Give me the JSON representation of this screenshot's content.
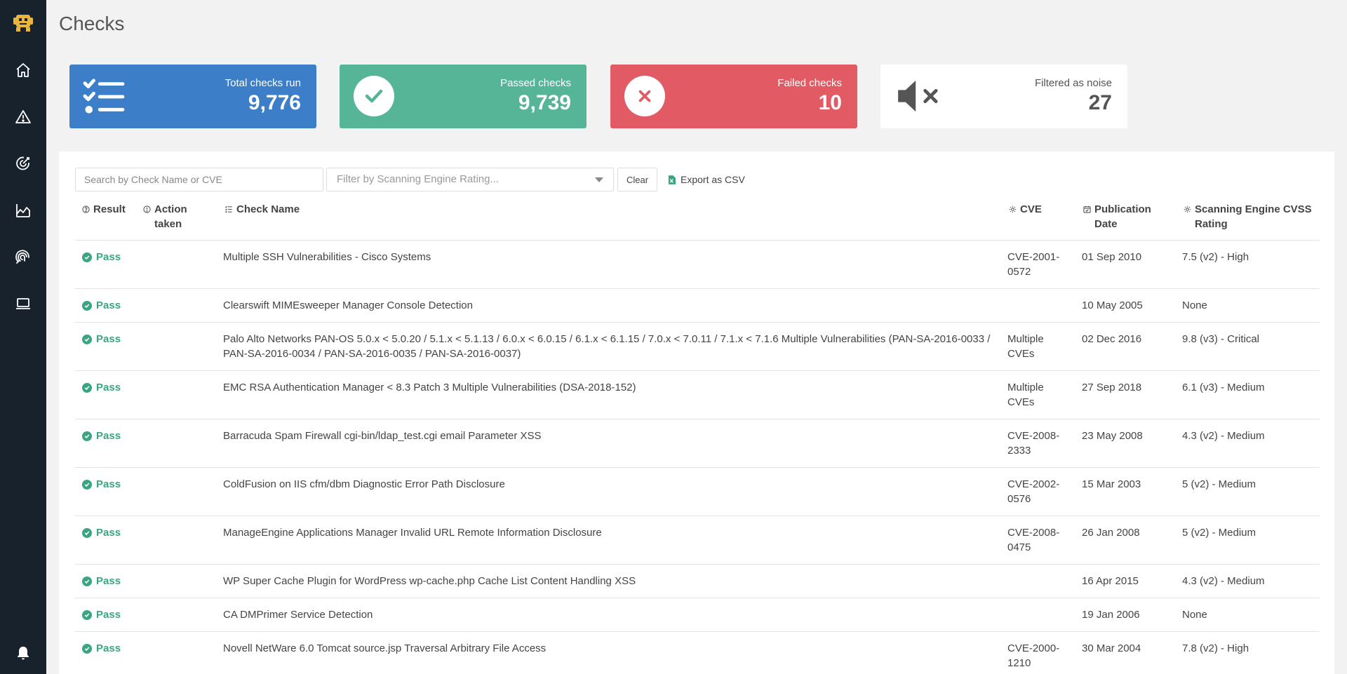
{
  "page": {
    "title": "Checks"
  },
  "colors": {
    "sidebar": "#17222c",
    "blue": "#3d7ec8",
    "green": "#56b497",
    "red": "#e25a63",
    "pass": "#3aa57f"
  },
  "sidebar": {
    "items": [
      {
        "icon": "home-icon"
      },
      {
        "icon": "warning-icon"
      },
      {
        "icon": "target-icon"
      },
      {
        "icon": "chart-icon"
      },
      {
        "icon": "fingerprint-icon"
      },
      {
        "icon": "laptop-icon"
      },
      {
        "icon": "bell-icon"
      }
    ]
  },
  "stats": {
    "total": {
      "label": "Total checks run",
      "value": "9,776"
    },
    "passed": {
      "label": "Passed checks",
      "value": "9,739"
    },
    "failed": {
      "label": "Failed checks",
      "value": "10"
    },
    "noise": {
      "label": "Filtered as noise",
      "value": "27"
    }
  },
  "toolbar": {
    "search_placeholder": "Search by Check Name or CVE",
    "filter_placeholder": "Filter by Scanning Engine Rating...",
    "clear_label": "Clear",
    "export_label": "Export as CSV"
  },
  "table": {
    "columns": {
      "result": "Result",
      "action": "Action taken",
      "name": "Check Name",
      "cve": "CVE",
      "date": "Publication Date",
      "rating": "Scanning Engine CVSS Rating"
    },
    "rows": [
      {
        "result": "Pass",
        "name": "Multiple SSH Vulnerabilities - Cisco Systems",
        "cve": "CVE-2001-0572",
        "date": "01 Sep 2010",
        "rating": "7.5 (v2) - High"
      },
      {
        "result": "Pass",
        "name": "Clearswift MIMEsweeper Manager Console Detection",
        "cve": "",
        "date": "10 May 2005",
        "rating": "None"
      },
      {
        "result": "Pass",
        "name": "Palo Alto Networks PAN-OS 5.0.x < 5.0.20 / 5.1.x < 5.1.13 / 6.0.x < 6.0.15 / 6.1.x < 6.1.15 / 7.0.x < 7.0.11 / 7.1.x < 7.1.6 Multiple Vulnerabilities (PAN-SA-2016-0033 / PAN-SA-2016-0034 / PAN-SA-2016-0035 / PAN-SA-2016-0037)",
        "cve": "Multiple CVEs",
        "date": "02 Dec 2016",
        "rating": "9.8 (v3) - Critical"
      },
      {
        "result": "Pass",
        "name": "EMC RSA Authentication Manager < 8.3 Patch 3 Multiple Vulnerabilities (DSA-2018-152)",
        "cve": "Multiple CVEs",
        "date": "27 Sep 2018",
        "rating": "6.1 (v3) - Medium"
      },
      {
        "result": "Pass",
        "name": "Barracuda Spam Firewall cgi-bin/ldap_test.cgi email Parameter XSS",
        "cve": "CVE-2008-2333",
        "date": "23 May 2008",
        "rating": "4.3 (v2) - Medium"
      },
      {
        "result": "Pass",
        "name": "ColdFusion on IIS cfm/dbm Diagnostic Error Path Disclosure",
        "cve": "CVE-2002-0576",
        "date": "15 Mar 2003",
        "rating": "5 (v2) - Medium"
      },
      {
        "result": "Pass",
        "name": "ManageEngine Applications Manager Invalid URL Remote Information Disclosure",
        "cve": "CVE-2008-0475",
        "date": "26 Jan 2008",
        "rating": "5 (v2) - Medium"
      },
      {
        "result": "Pass",
        "name": "WP Super Cache Plugin for WordPress wp-cache.php Cache List Content Handling XSS",
        "cve": "",
        "date": "16 Apr 2015",
        "rating": "4.3 (v2) - Medium"
      },
      {
        "result": "Pass",
        "name": "CA DMPrimer Service Detection",
        "cve": "",
        "date": "19 Jan 2006",
        "rating": "None"
      },
      {
        "result": "Pass",
        "name": "Novell NetWare 6.0 Tomcat source.jsp Traversal Arbitrary File Access",
        "cve": "CVE-2000-1210",
        "date": "30 Mar 2004",
        "rating": "7.8 (v2) - High"
      }
    ]
  }
}
